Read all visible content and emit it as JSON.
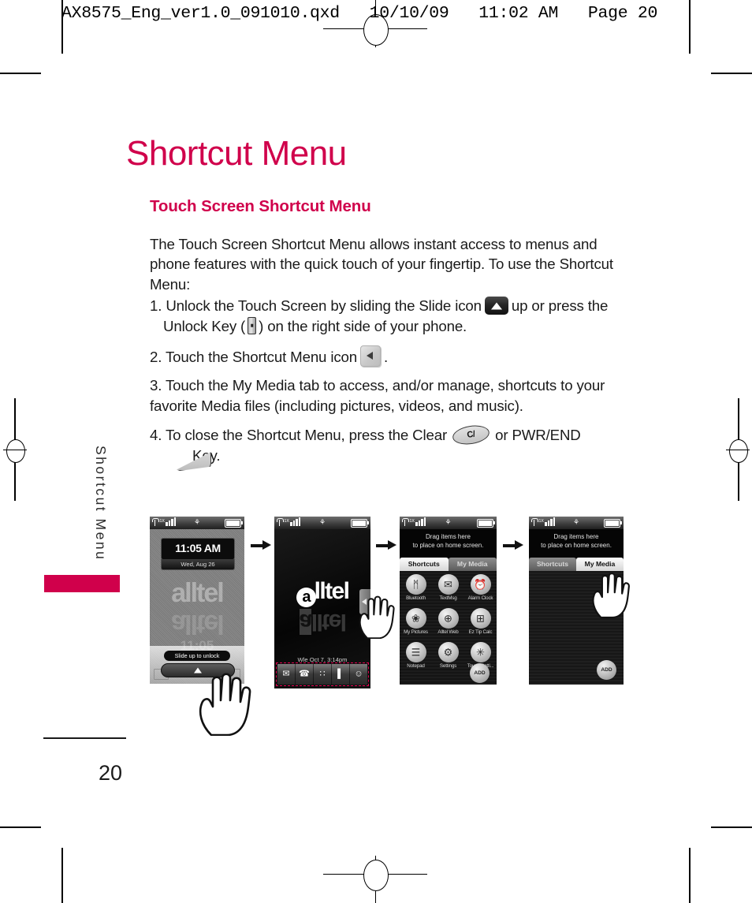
{
  "page_header": "AX8575_Eng_ver1.0_091010.qxd   10/10/09   11:02 AM   Page 20",
  "title": "Shortcut Menu",
  "subtitle": "Touch Screen Shortcut Menu",
  "intro": "The Touch Screen Shortcut Menu allows instant access to menus and phone features with the quick touch of your fingertip. To use the Shortcut Menu:",
  "steps": {
    "s1a": "1. Unlock the Touch Screen by sliding the Slide icon",
    "s1b": "up or press the",
    "s1c": "Unlock Key (",
    "s1d": ") on the right side of your phone.",
    "s2a": "2.  Touch the Shortcut Menu icon",
    "s2b": ".",
    "s3": "3.  Touch the My Media tab to access, and/or manage, shortcuts to your favorite Media files (including pictures, videos, and music).",
    "s4a": "4.  To close the Shortcut Menu, press the Clear",
    "s4b": "or PWR/END",
    "s4c": "Key."
  },
  "key_labels": {
    "clear": "C/",
    "pwr_end_line1": "PWR",
    "pwr_end_line2": "END"
  },
  "side_tab": {
    "label": "Shortcut Menu",
    "accent_color": "#d0004b"
  },
  "page_number": "20",
  "phones": {
    "phone1": {
      "status": {
        "network": "1X",
        "signal_bars": 4,
        "battery": "full"
      },
      "clock": "11:05 AM",
      "date": "Wed, Aug 26",
      "wallpaper_text": "alltel",
      "ghost_clock": "11:05",
      "slide_label": "Slide up to unlock"
    },
    "phone2": {
      "status": {
        "network": "1X",
        "signal_bars": 4,
        "battery": "full"
      },
      "logo_a": "a",
      "logo_rest": "lltel",
      "date": "Wle  Oct 7,  3:14pm",
      "dock_icons": [
        "mail-icon",
        "call-icon",
        "menu-dots-icon",
        "contacts-icon",
        "favorite-contact-icon"
      ],
      "dock_glyphs": [
        "✉",
        "☎",
        "∷",
        "▌",
        "☺"
      ]
    },
    "phone3": {
      "status": {
        "network": "1X",
        "signal_bars": 4,
        "battery": "full"
      },
      "drag_line1": "Drag items here",
      "drag_line2": "to place on home screen.",
      "tabs": [
        {
          "label": "Shortcuts",
          "active": true
        },
        {
          "label": "My Media",
          "active": false
        }
      ],
      "shortcuts": [
        {
          "label": "Bluetooth",
          "glyph": "ᛗ"
        },
        {
          "label": "TextMsg",
          "glyph": "✉"
        },
        {
          "label": "Alarm Clock",
          "glyph": "⏰"
        },
        {
          "label": "My Pictures",
          "glyph": "❀"
        },
        {
          "label": "Alltel Web",
          "glyph": "⊕"
        },
        {
          "label": "Ez Tip Calc",
          "glyph": "⊞"
        },
        {
          "label": "Notepad",
          "glyph": "☰"
        },
        {
          "label": "Settings",
          "glyph": "⚙"
        },
        {
          "label": "Touch Setti...",
          "glyph": "✳"
        }
      ],
      "add_button": "ADD"
    },
    "phone4": {
      "status": {
        "network": "1X",
        "signal_bars": 4,
        "battery": "full"
      },
      "drag_line1": "Drag items here",
      "drag_line2": "to place on home screen.",
      "tabs": [
        {
          "label": "Shortcuts",
          "active": false
        },
        {
          "label": "My Media",
          "active": true
        }
      ],
      "shortcuts": [],
      "add_button": "ADD"
    }
  }
}
